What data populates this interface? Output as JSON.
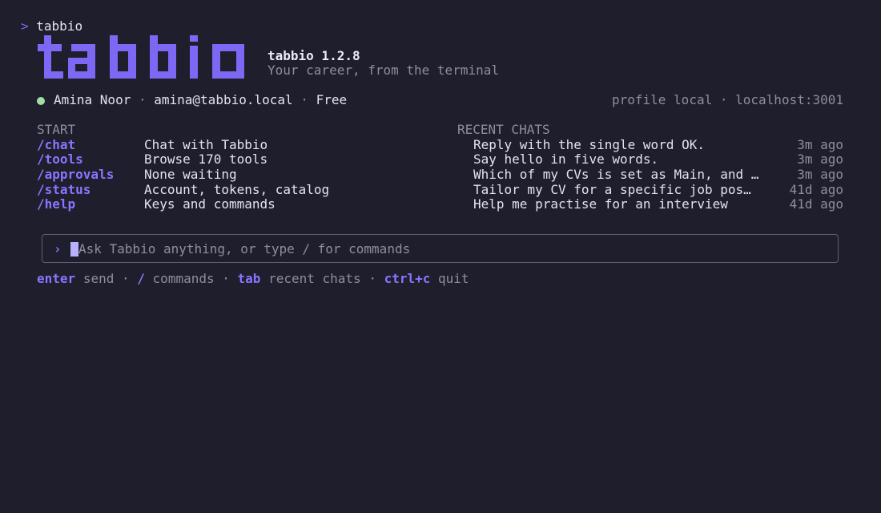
{
  "shell": {
    "prompt_symbol": ">",
    "command": "tabbio"
  },
  "brand": {
    "logo_text": "tabbio",
    "version_line": "tabbio 1.2.8",
    "tagline": "Your career, from the terminal",
    "accent_color": "#7c68f5"
  },
  "account": {
    "status_color": "#9ee0a0",
    "name": "Amina Noor",
    "separator": "·",
    "email": "amina@tabbio.local",
    "plan": "Free",
    "profile_label": "profile local",
    "host": "localhost:3001"
  },
  "start": {
    "heading": "START",
    "items": [
      {
        "command": "/chat",
        "description": "Chat with Tabbio"
      },
      {
        "command": "/tools",
        "description": "Browse 170 tools"
      },
      {
        "command": "/approvals",
        "description": "None waiting"
      },
      {
        "command": "/status",
        "description": "Account, tokens, catalog"
      },
      {
        "command": "/help",
        "description": "Keys and commands"
      }
    ]
  },
  "recent_chats": {
    "heading": "RECENT CHATS",
    "items": [
      {
        "title": "Reply with the single word OK.",
        "time": "3m ago"
      },
      {
        "title": "Say hello in five words.",
        "time": "3m ago"
      },
      {
        "title": "Which of my CVs is set as Main, and …",
        "time": "3m ago"
      },
      {
        "title": "Tailor my CV for a specific job pos…",
        "time": "41d ago"
      },
      {
        "title": "Help me practise for an interview",
        "time": "41d ago"
      }
    ]
  },
  "input": {
    "chevron": "›",
    "placeholder": "Ask Tabbio anything, or type / for commands"
  },
  "hints": [
    {
      "key": "enter",
      "action": "send"
    },
    {
      "key": "/",
      "action": "commands"
    },
    {
      "key": "tab",
      "action": "recent chats"
    },
    {
      "key": "ctrl+c",
      "action": "quit"
    }
  ],
  "hint_separator": "·"
}
